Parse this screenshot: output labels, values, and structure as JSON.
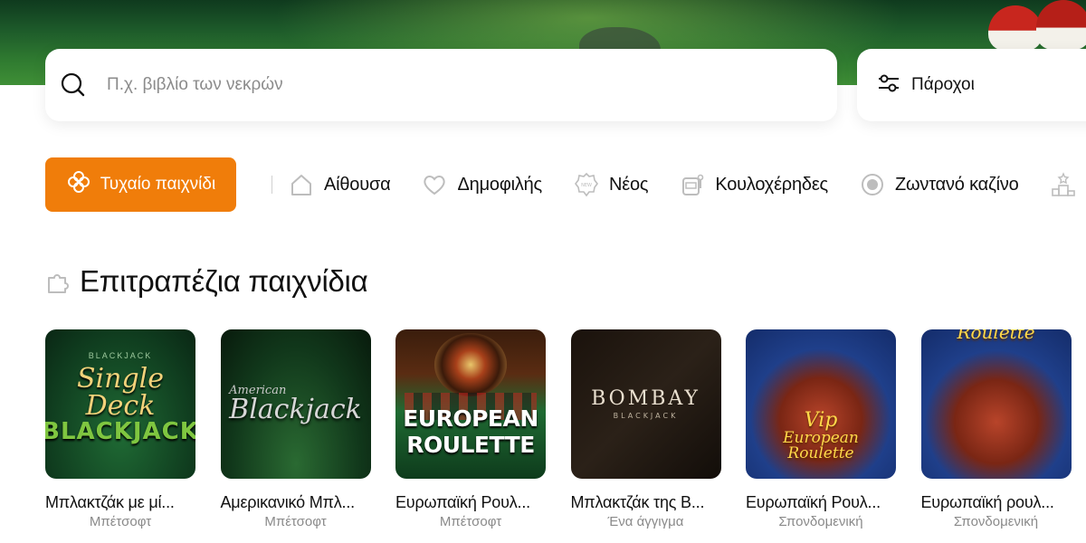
{
  "search": {
    "placeholder": "Π.χ. βιβλίο των νεκρών",
    "icon": "search-icon"
  },
  "providers": {
    "label": "Πάροχοι",
    "icon": "sliders-icon"
  },
  "random_game": {
    "label": "Τυχαίο παιχνίδι",
    "icon": "clover-icon",
    "color": "#f07d0a"
  },
  "categories": [
    {
      "label": "Αίθουσα",
      "icon": "home-icon"
    },
    {
      "label": "Δημοφιλής",
      "icon": "heart-icon"
    },
    {
      "label": "Νέος",
      "icon": "new-badge-icon"
    },
    {
      "label": "Κουλοχέρηδες",
      "icon": "slot-machine-icon"
    },
    {
      "label": "Ζωντανό καζίνο",
      "icon": "live-dot-icon"
    }
  ],
  "section": {
    "title": "Επιτραπέζια παιχνίδια",
    "icon": "puzzle-icon"
  },
  "games": [
    {
      "name": "Μπλακτζάκ με μί...",
      "provider": "Μπέτσοφτ",
      "art_line1": "Single Deck",
      "art_line2": "BLACKJACK",
      "art_top": "BLACKJACK"
    },
    {
      "name": "Αμερικανικό Μπλ...",
      "provider": "Μπέτσοφτ",
      "art_line1": "American",
      "art_line2": "Blackjack"
    },
    {
      "name": "Ευρωπαϊκή Ρουλ...",
      "provider": "Μπέτσοφτ",
      "art_line1": "EUROPEAN",
      "art_line2": "ROULETTE"
    },
    {
      "name": "Μπλακτζάκ της Β...",
      "provider": "Ένα άγγιγμα",
      "art_line1": "BOMBAY",
      "art_line2": "BLACKJACK"
    },
    {
      "name": "Ευρωπαϊκή Ρουλ...",
      "provider": "Σπονδομενική",
      "art_line1": "Vip",
      "art_line2": "European Roulette"
    },
    {
      "name": "Ευρωπαϊκή ρουλ...",
      "provider": "Σπονδομενική",
      "art_line1": "European Roulette"
    }
  ],
  "colors": {
    "accent": "#f07d0a",
    "muted_text": "#8a8a8a"
  }
}
